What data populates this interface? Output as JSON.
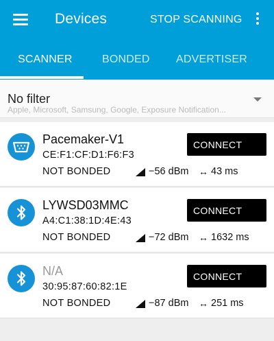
{
  "app": {
    "title": "Devices",
    "stop_label": "STOP SCANNING",
    "accent_color": "#009fda"
  },
  "tabs": [
    {
      "label": "SCANNER",
      "selected": true
    },
    {
      "label": "BONDED",
      "selected": false
    },
    {
      "label": "ADVERTISER",
      "selected": false
    }
  ],
  "filter": {
    "label": "No filter",
    "hint": "Apple, Microsoft, Samsung, Google, Exposure Notification..."
  },
  "devices": [
    {
      "name": "Pacemaker-V1",
      "address": "CE:F1:CF:D1:F6:F3",
      "bond_state": "NOT BONDED",
      "rssi": "−56 dBm",
      "interval": "43 ms",
      "icon": "serial-port-icon",
      "connect_label": "CONNECT"
    },
    {
      "name": "LYWSD03MMC",
      "address": "A4:C1:38:1D:4E:43",
      "bond_state": "NOT BONDED",
      "rssi": "−72 dBm",
      "interval": "1632 ms",
      "icon": "bluetooth-icon",
      "connect_label": "CONNECT"
    },
    {
      "name": "N/A",
      "address": "30:95:87:60:82:1E",
      "bond_state": "NOT BONDED",
      "rssi": "−87 dBm",
      "interval": "251 ms",
      "icon": "bluetooth-icon",
      "connect_label": "CONNECT"
    }
  ],
  "interval_symbol": "↔"
}
